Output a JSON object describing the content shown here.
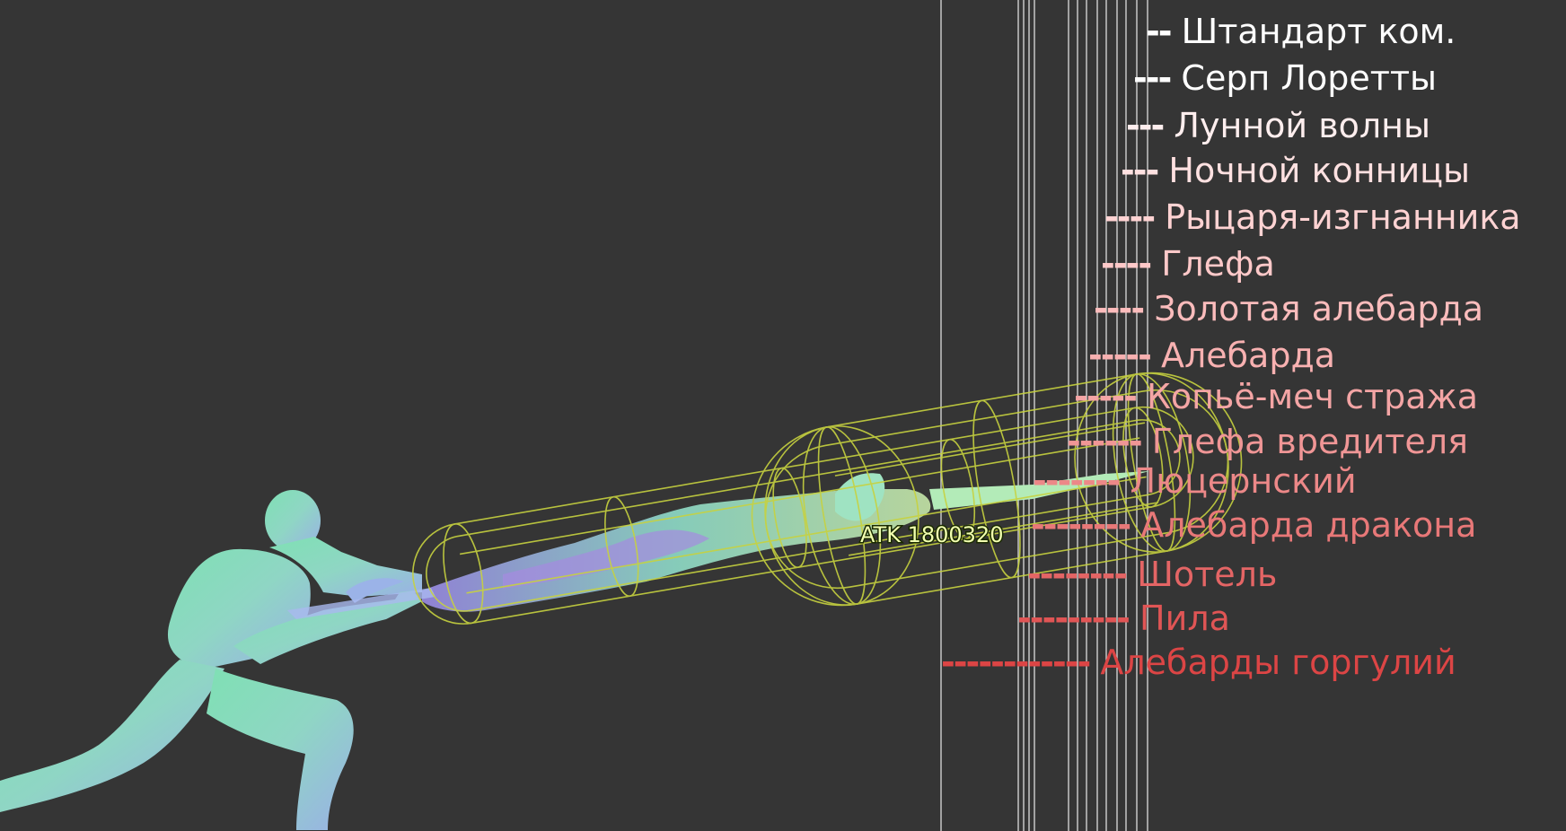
{
  "hitbox": {
    "atk_label": "ATK 1800320"
  },
  "weapons": [
    {
      "dashes": "--",
      "name": "Штандарт ком.",
      "color": "#ffffff"
    },
    {
      "dashes": "---",
      "name": "Серп Лоретты",
      "color": "#ffffff"
    },
    {
      "dashes": "---",
      "name": "Лунной волны",
      "color": "#ffeeee"
    },
    {
      "dashes": "---",
      "name": "Ночной конницы",
      "color": "#ffe1e1"
    },
    {
      "dashes": "----",
      "name": "Рыцаря-изгнанника",
      "color": "#ffd3d3"
    },
    {
      "dashes": "----",
      "name": "Глефа",
      "color": "#ffc9c9"
    },
    {
      "dashes": "----",
      "name": "Золотая алебарда",
      "color": "#fbbcbc"
    },
    {
      "dashes": "-----",
      "name": "Алебарда",
      "color": "#f8b1b1"
    },
    {
      "dashes": "-----",
      "name": "Копьё-меч стража",
      "color": "#f4a5a5"
    },
    {
      "dashes": "------",
      "name": "Глефа вредителя",
      "color": "#f09696"
    },
    {
      "dashes": "-------",
      "name": "Люцернский",
      "color": "#ec8888"
    },
    {
      "dashes": "--------",
      "name": "Алебарда дракона",
      "color": "#e87878"
    },
    {
      "dashes": "--------",
      "name": "Шотель",
      "color": "#e46565"
    },
    {
      "dashes": "---------",
      "name": "Пила",
      "color": "#e05555"
    },
    {
      "dashes": "------------",
      "name": "Алебарды горгулий",
      "color": "#dc4545"
    }
  ]
}
